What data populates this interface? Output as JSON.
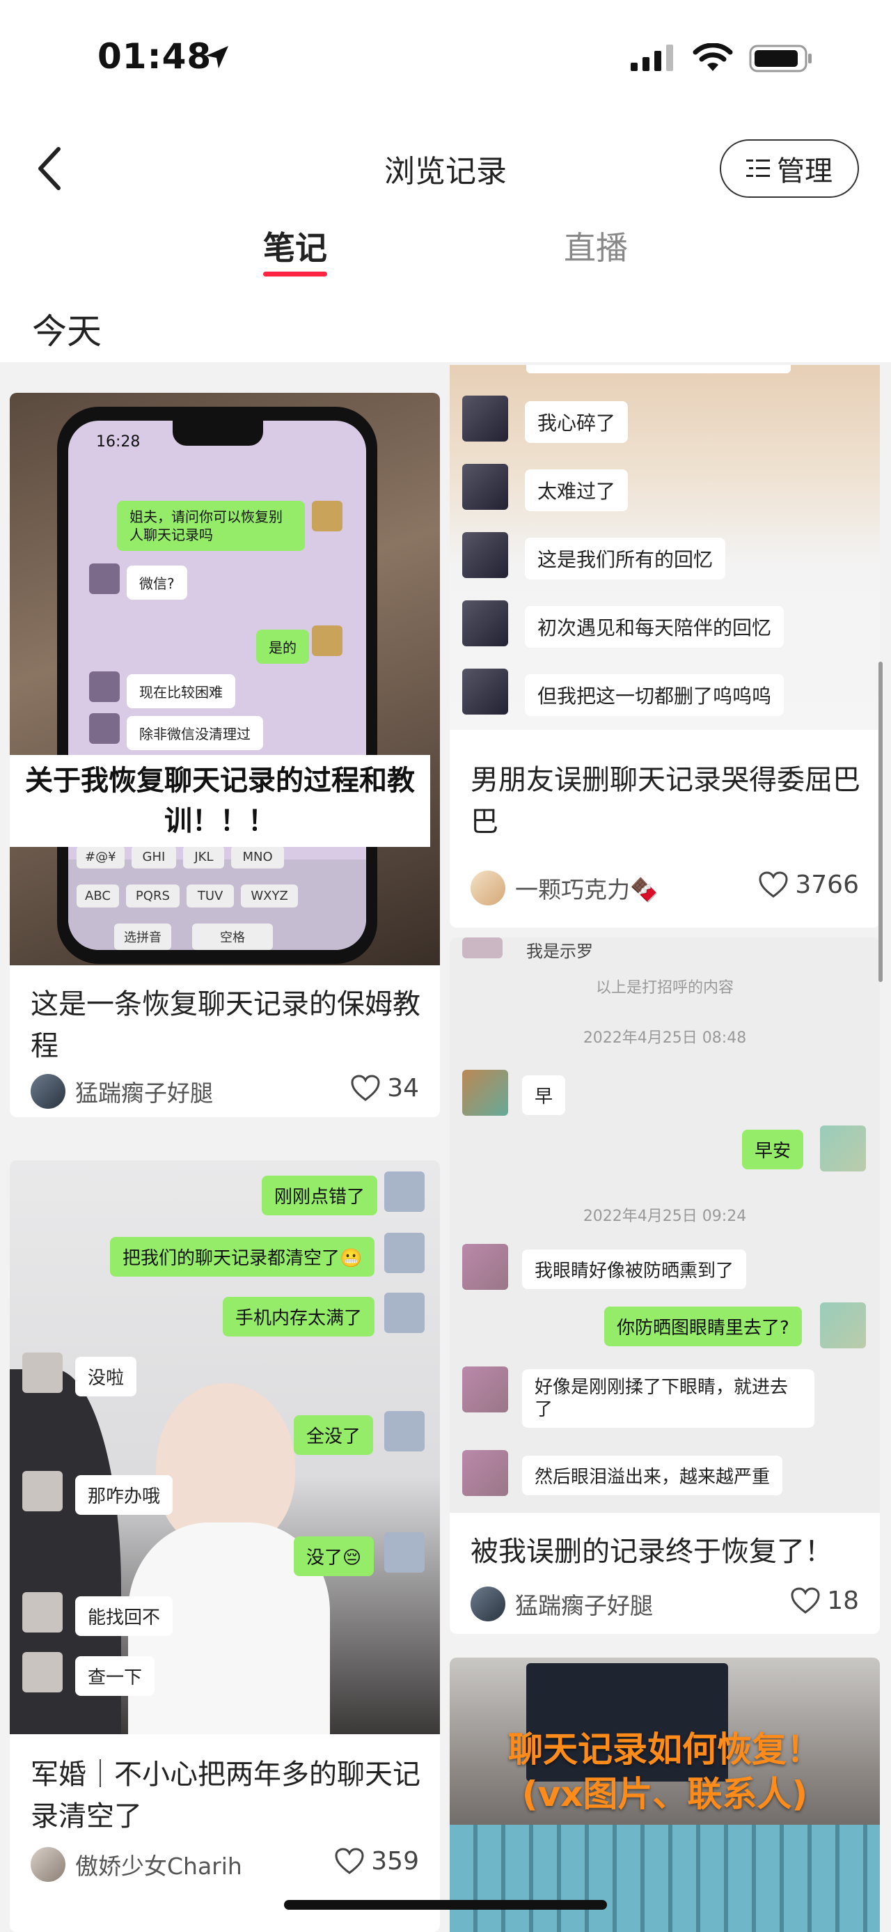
{
  "status": {
    "time": "01:48"
  },
  "nav": {
    "title": "浏览记录",
    "manage_label": "管理"
  },
  "tabs": [
    {
      "label": "笔记"
    },
    {
      "label": "直播"
    }
  ],
  "section": {
    "label": "今天"
  },
  "cards": [
    {
      "cover_caption": "关于我恢复聊天记录的过程和教训！！！",
      "phone_time": "16:28",
      "bubbles": [
        "姐夫，请问你可以恢复别人聊天记录吗",
        "微信?",
        "是的",
        "现在比较困难",
        "除非微信没清理过"
      ],
      "keys": [
        "#@¥",
        "GHI",
        "JKL",
        "MNO",
        "ABC",
        "PQRS",
        "TUV",
        "WXYZ",
        "选拼音",
        "空格"
      ],
      "title": "这是一条恢复聊天记录的保姆教程",
      "author": "猛踹瘸子好腿",
      "likes": "34"
    },
    {
      "bubbles": [
        "我心碎了",
        "太难过了",
        "这是我们所有的回忆",
        "初次遇见和每天陪伴的回忆",
        "但我把这一切都删了呜呜呜"
      ],
      "title": "男朋友误删聊天记录哭得委屈巴巴",
      "author": "一颗巧克力🍫",
      "likes": "3766"
    },
    {
      "bubbles": [
        "刚刚点错了",
        "把我们的聊天记录都清空了😬",
        "手机内存太满了",
        "没啦",
        "全没了",
        "那咋办哦",
        "没了😔",
        "能找回不",
        "查一下"
      ],
      "title": "军婚｜不小心把两年多的聊天记录清空了",
      "author": "傲娇少女Charih",
      "likes": "359"
    },
    {
      "chat_top": "我是示罗",
      "notice": "以上是打招呼的内容",
      "ts1": "2022年4月25日 08:48",
      "ts2": "2022年4月25日 09:24",
      "bubbles": [
        "早",
        "早安",
        "我眼睛好像被防晒熏到了",
        "你防晒图眼睛里去了?",
        "好像是刚刚揉了下眼睛，就进去了",
        "然后眼泪溢出来，越来越严重"
      ],
      "title": "被我误删的记录终于恢复了！",
      "author": "猛踹瘸子好腿",
      "likes": "18"
    },
    {
      "cover_line1": "聊天记录如何恢复！",
      "cover_line2": "(vx图片、联系人)"
    }
  ]
}
